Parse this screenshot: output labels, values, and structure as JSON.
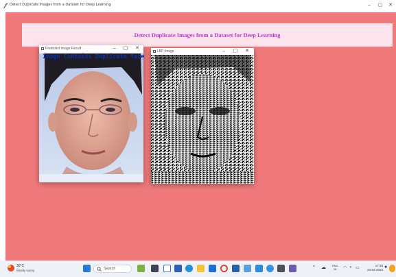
{
  "window": {
    "title": "Detect Duplicate Images from a Dataset for Deep Learning",
    "minimize_icon": "minimize-icon",
    "maximize_icon": "maximize-icon",
    "close_icon": "close-icon"
  },
  "header": {
    "title": "Detect Duplicate Images from a Dataset for Deep Learning",
    "title_color": "#c03ad8",
    "banner_color": "#fde3ec"
  },
  "background_color": "#f07a7b",
  "predicted_window": {
    "title": "Predicted Image Result",
    "caption": "Image Contains Duplicate face",
    "caption_color": "#0a2fb0"
  },
  "lbp_window": {
    "title": "LBP Image"
  },
  "taskbar": {
    "weather_temp": "30°C",
    "weather_condition": "Mostly sunny",
    "search_label": "Search",
    "lang_line1": "ENG",
    "lang_line2": "IN",
    "time": "17:33",
    "date": "23-03-2024"
  }
}
